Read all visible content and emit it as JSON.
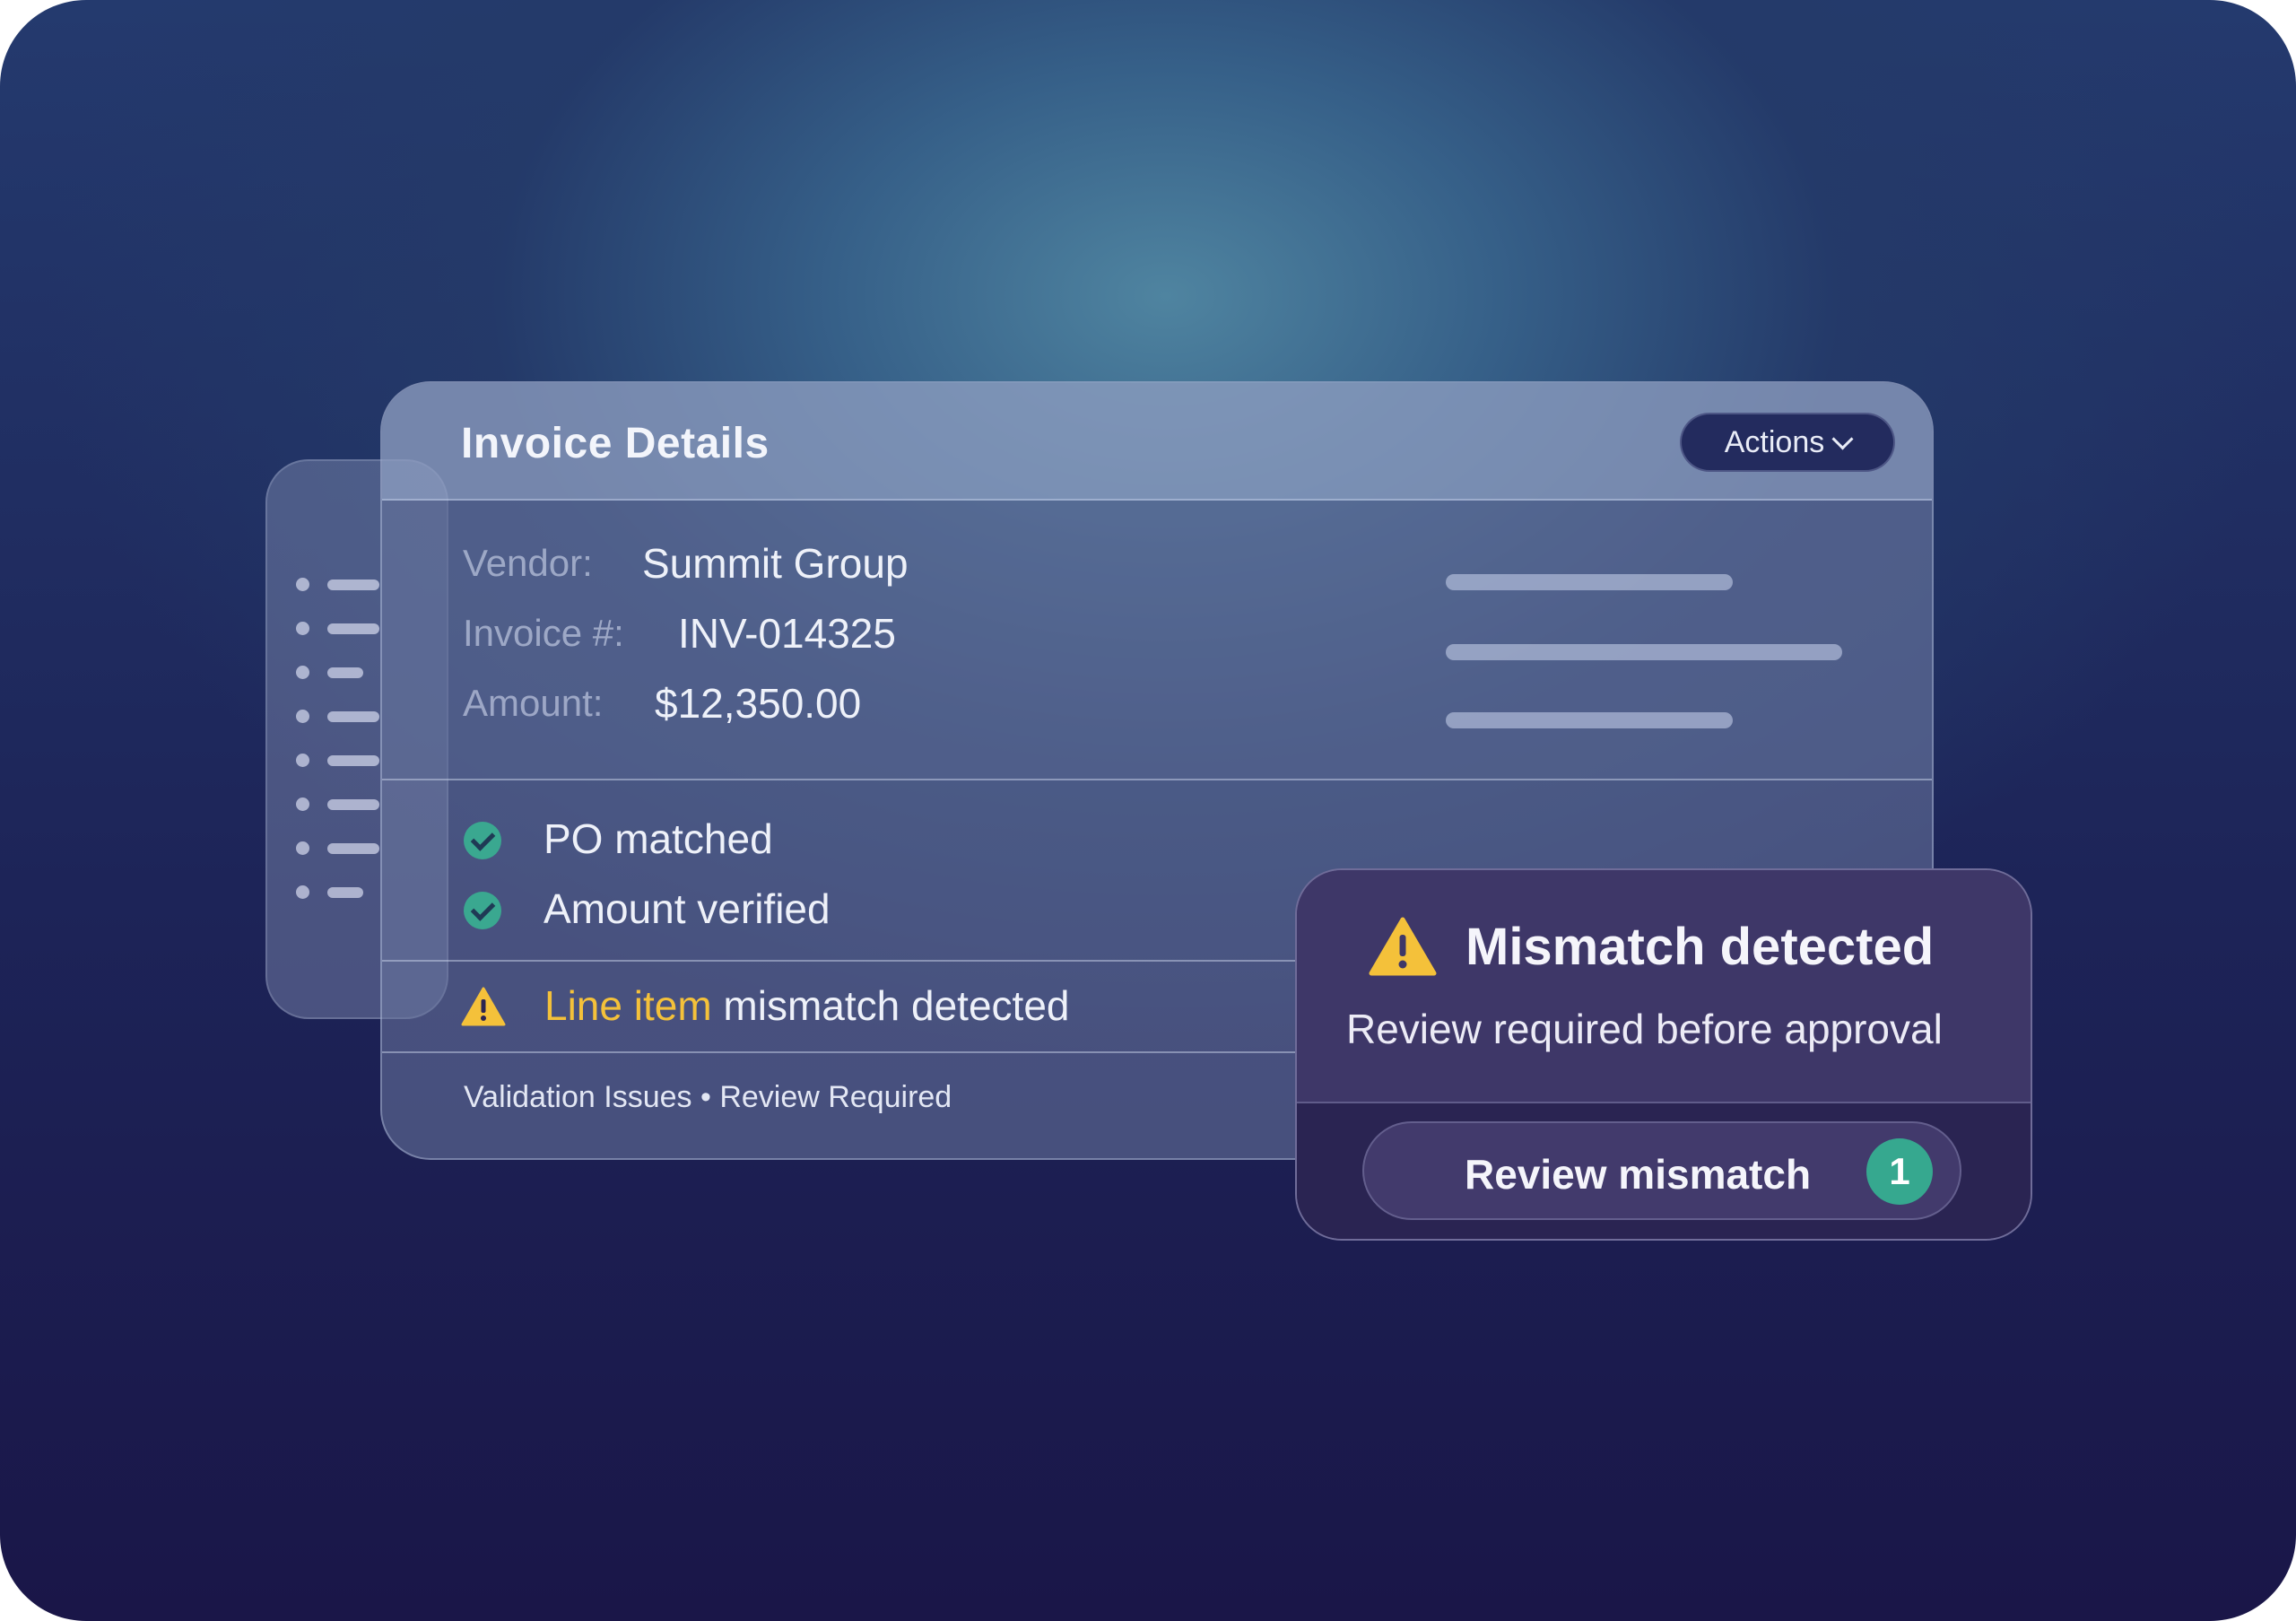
{
  "card": {
    "title": "Invoice Details",
    "actions_label": "Actions",
    "fields": [
      {
        "label": "Vendor:",
        "value": "Summit Group"
      },
      {
        "label": "Invoice #:",
        "value": "INV-014325"
      },
      {
        "label": "Amount:",
        "value": "$12,350.00"
      }
    ],
    "checks": [
      {
        "label": "PO matched",
        "icon": "check-circle-icon"
      },
      {
        "label": "Amount verified",
        "icon": "check-circle-icon"
      }
    ],
    "warning": {
      "highlight": "Line item",
      "rest": " mismatch detected",
      "icon": "warning-triangle-icon"
    },
    "footer": "Validation Issues • Review Required"
  },
  "alert": {
    "title": "Mismatch detected",
    "subtitle": "Review required before approval",
    "button_label": "Review mismatch",
    "badge_count": "1",
    "icon": "warning-triangle-icon"
  },
  "colors": {
    "accent_green": "#36a88f",
    "warning_yellow": "#f4c13a",
    "dark_navy": "#232b5e",
    "alert_purple": "#40386a"
  }
}
